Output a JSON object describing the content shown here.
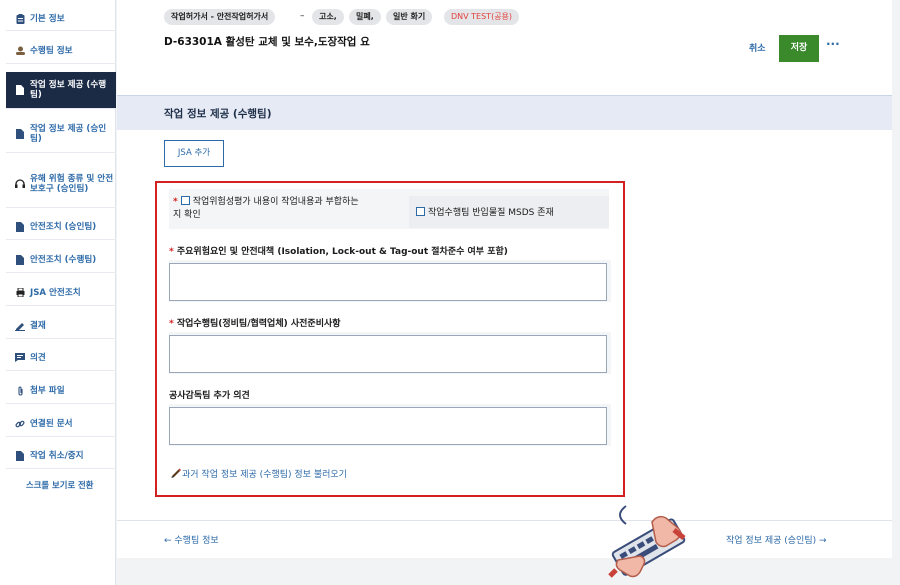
{
  "sidebar": {
    "items": [
      {
        "label": "기본 정보",
        "icon": "clipboard-icon"
      },
      {
        "label": "수행팀 정보",
        "icon": "team-icon"
      },
      {
        "label": "작업 정보 제공 (수행팀)",
        "icon": "document-icon",
        "active": true
      },
      {
        "label": "작업 정보 제공 (승인팀)",
        "icon": "document-icon"
      },
      {
        "label": "유해 위험 종류 및 안전보호구 (승인팀)",
        "icon": "headset-icon"
      },
      {
        "label": "안전조치 (승인팀)",
        "icon": "document-icon"
      },
      {
        "label": "안전조치 (수행팀)",
        "icon": "document-icon"
      },
      {
        "label": "JSA 안전조치",
        "icon": "printer-icon"
      },
      {
        "label": "결재",
        "icon": "pen-icon"
      },
      {
        "label": "의견",
        "icon": "comment-icon"
      },
      {
        "label": "첨부 파일",
        "icon": "paperclip-icon"
      },
      {
        "label": "연결된 문서",
        "icon": "link-icon"
      },
      {
        "label": "작업 취소/중지",
        "icon": "document-icon"
      }
    ],
    "scroll_toggle": "스크롤 보기로 전환"
  },
  "header": {
    "tags": [
      "작업허가서 - 안전작업허가서",
      "고소,",
      "밀폐,",
      "일반 화기",
      "DNV TEST(공용)"
    ],
    "dash": "–",
    "doc_title": "D-63301A 활성탄 교체 및 보수,도장작업 요",
    "cancel_label": "취소",
    "save_label": "저장",
    "more_label": "···"
  },
  "section": {
    "title": "작업 정보 제공 (수행팀)",
    "jsa_button": "JSA 추가",
    "checkbox1_star": "*",
    "checkbox1_label": "작업위험성평가 내용이 작업내용과 부합하는지 확인",
    "checkbox2_label": "작업수행팀 반입물질 MSDS 존재",
    "field1_label": "주요위험요인 및 안전대책 (Isolation, Lock-out & Tag-out 절차준수 여부 포함)",
    "field2_label": "작업수행팀(정비팀/협력업체) 사전준비사항",
    "field3_label": "공사감독팀 추가 의견",
    "required_star": "*",
    "load_link": "과거 작업 정보 제공 (수행팀) 정보 불러오기"
  },
  "footer": {
    "prev_label": "← 수행팀 정보",
    "next_label": "작업 정보 제공 (승인팀) →"
  },
  "colors": {
    "accent": "#2d6aa8",
    "save": "#3a8a2c",
    "highlight_box": "#d32020",
    "sidebar_active": "#1b2a45"
  }
}
